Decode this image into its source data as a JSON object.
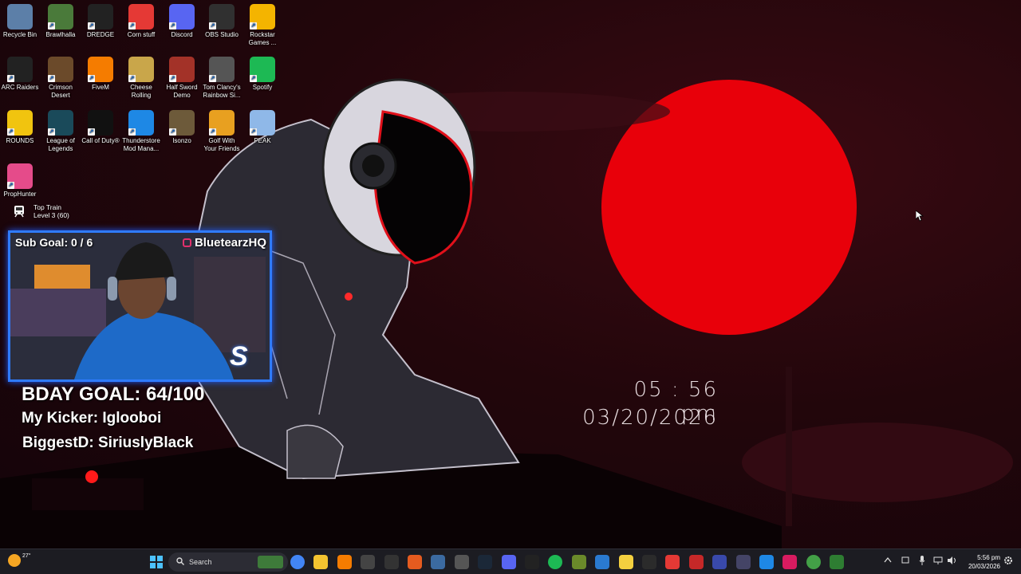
{
  "desktop_icons": [
    {
      "label": "Recycle Bin",
      "icon": "recycle-bin-icon",
      "color": "#5c7fa8"
    },
    {
      "label": "Brawlhalla",
      "icon": "brawlhalla-icon",
      "color": "#4a7a3a"
    },
    {
      "label": "DREDGE",
      "icon": "dredge-icon",
      "color": "#222222"
    },
    {
      "label": "Corn stuff",
      "icon": "power-icon",
      "color": "#e53935"
    },
    {
      "label": "Discord",
      "icon": "discord-icon",
      "color": "#5865f2"
    },
    {
      "label": "OBS Studio",
      "icon": "obs-icon",
      "color": "#303030"
    },
    {
      "label": "Rockstar Games ...",
      "icon": "rockstar-icon",
      "color": "#f4b400"
    },
    {
      "label": "ARC Raiders",
      "icon": "arc-raiders-icon",
      "color": "#222222"
    },
    {
      "label": "Crimson Desert",
      "icon": "crimson-desert-icon",
      "color": "#6b4a2a"
    },
    {
      "label": "FiveM",
      "icon": "fivem-icon",
      "color": "#f57c00"
    },
    {
      "label": "Cheese Rolling",
      "icon": "cheese-icon",
      "color": "#c9a64a"
    },
    {
      "label": "Half Sword Demo",
      "icon": "half-sword-icon",
      "color": "#a33228"
    },
    {
      "label": "Tom Clancy's Rainbow Si...",
      "icon": "rainbow-six-icon",
      "color": "#555555"
    },
    {
      "label": "Spotify",
      "icon": "spotify-icon",
      "color": "#1db954"
    },
    {
      "label": "ROUNDS",
      "icon": "rounds-icon",
      "color": "#f1c40f"
    },
    {
      "label": "League of Legends",
      "icon": "league-icon",
      "color": "#1a4a5a"
    },
    {
      "label": "Call of Duty®",
      "icon": "call-of-duty-icon",
      "color": "#111111"
    },
    {
      "label": "Thunderstore Mod Mana...",
      "icon": "thunderstore-icon",
      "color": "#1e88e5"
    },
    {
      "label": "Isonzo",
      "icon": "isonzo-icon",
      "color": "#6d5a3a"
    },
    {
      "label": "Golf With Your Friends",
      "icon": "golf-icon",
      "color": "#e8a020"
    },
    {
      "label": "PEAK",
      "icon": "peak-icon",
      "color": "#8fb8e8"
    },
    {
      "label": "PropHunter",
      "icon": "prophunter-icon",
      "color": "#e54b8a"
    }
  ],
  "top_train": {
    "title": "Top Train",
    "subtitle": "Level 3  (60)"
  },
  "clock": {
    "time": "05 : 56  pm",
    "date": "03/20/2026"
  },
  "stream_overlay": {
    "sub_goal": "Sub Goal:  0 / 6",
    "handle": "BluetearzHQ",
    "bday_goal": "BDAY GOAL: 64/100",
    "kicker": "My Kicker: Iglooboi",
    "biggest": "BiggestD: SiriuslyBlack"
  },
  "taskbar": {
    "weather_temp": "27°",
    "search_placeholder": "Search",
    "apps": [
      {
        "name": "chrome-icon",
        "color": "#4285f4"
      },
      {
        "name": "file-explorer-icon",
        "color": "#f4c430"
      },
      {
        "name": "vlc-icon",
        "color": "#f57c00"
      },
      {
        "name": "obs-icon",
        "color": "#444444"
      },
      {
        "name": "epic-games-icon",
        "color": "#333333"
      },
      {
        "name": "firefox-icon",
        "color": "#e55b1f"
      },
      {
        "name": "app-icon",
        "color": "#3b6aa0"
      },
      {
        "name": "game-icon",
        "color": "#555555"
      },
      {
        "name": "steam-icon",
        "color": "#1b2838"
      },
      {
        "name": "discord-icon",
        "color": "#5865f2"
      },
      {
        "name": "capcut-icon",
        "color": "#222222"
      },
      {
        "name": "spotify-icon",
        "color": "#1db954"
      },
      {
        "name": "xbox-icon",
        "color": "#6a8a2a"
      },
      {
        "name": "photos-icon",
        "color": "#2a7ad0"
      },
      {
        "name": "sticky-notes-icon",
        "color": "#f4d03f"
      },
      {
        "name": "terminal-icon",
        "color": "#2b2b2b"
      },
      {
        "name": "power-icon",
        "color": "#e53935"
      },
      {
        "name": "f-icon",
        "color": "#c62828"
      },
      {
        "name": "diamond-icon",
        "color": "#3949ab"
      },
      {
        "name": "controller-icon",
        "color": "#444466"
      },
      {
        "name": "media-icon",
        "color": "#1e88e5"
      },
      {
        "name": "tiktok-icon",
        "color": "#d81b60"
      },
      {
        "name": "android-icon",
        "color": "#43a047"
      },
      {
        "name": "xbox-app-icon",
        "color": "#2e7d32"
      }
    ],
    "time": "5:56 pm",
    "date": "20/03/2026"
  }
}
